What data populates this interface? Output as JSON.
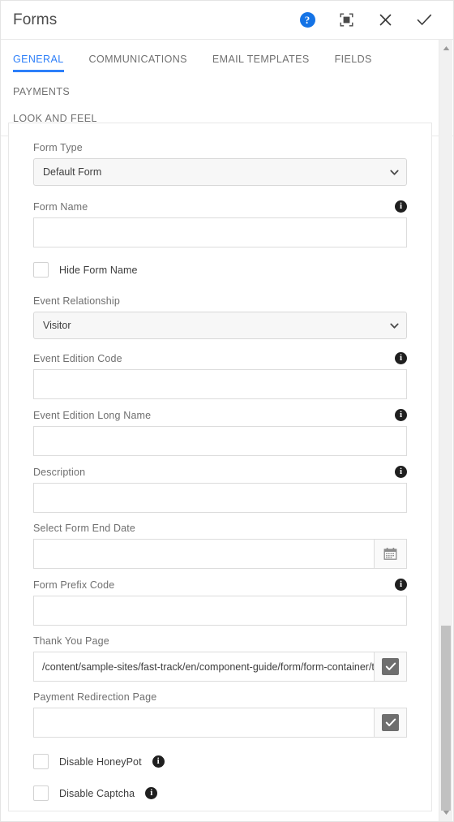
{
  "header": {
    "title": "Forms",
    "actions": [
      {
        "name": "help-icon",
        "label": "?"
      },
      {
        "name": "fullscreen-icon",
        "label": ""
      },
      {
        "name": "close-icon",
        "label": ""
      },
      {
        "name": "done-icon",
        "label": ""
      }
    ]
  },
  "tabs": {
    "row1": [
      {
        "label": "GENERAL",
        "active": true
      },
      {
        "label": "COMMUNICATIONS",
        "active": false
      },
      {
        "label": "EMAIL TEMPLATES",
        "active": false
      },
      {
        "label": "FIELDS",
        "active": false
      },
      {
        "label": "PAYMENTS",
        "active": false
      }
    ],
    "row2": [
      {
        "label": "LOOK AND FEEL",
        "active": false
      }
    ]
  },
  "form": {
    "form_type": {
      "label": "Form Type",
      "value": "Default Form"
    },
    "form_name": {
      "label": "Form Name",
      "value": "",
      "info": "i"
    },
    "hide_form_name": {
      "label": "Hide Form Name",
      "checked": false
    },
    "event_relationship": {
      "label": "Event Relationship",
      "value": "Visitor"
    },
    "event_edition_code": {
      "label": "Event Edition Code",
      "value": "",
      "info": "i"
    },
    "event_edition_long_name": {
      "label": "Event Edition Long Name",
      "value": "",
      "info": "i"
    },
    "description": {
      "label": "Description",
      "value": "",
      "info": "i"
    },
    "form_end_date": {
      "label": "Select Form End Date",
      "value": "",
      "button_icon": "calendar-icon"
    },
    "form_prefix_code": {
      "label": "Form Prefix Code",
      "value": "",
      "info": "i"
    },
    "thank_you_page": {
      "label": "Thank You Page",
      "value": "/content/sample-sites/fast-track/en/component-guide/form/form-container/t",
      "button_icon": "check-icon"
    },
    "payment_redirection_page": {
      "label": "Payment Redirection Page",
      "value": "",
      "button_icon": "check-icon"
    },
    "disable_honeypot": {
      "label": "Disable HoneyPot",
      "checked": false,
      "info": "i"
    },
    "disable_captcha": {
      "label": "Disable Captcha",
      "checked": false,
      "info": "i"
    }
  },
  "colors": {
    "accent": "#2d7ff9",
    "help_blue": "#1473e6",
    "info_dot": "#1f1f1f",
    "button_grey": "#6e6e6e",
    "scroll_thumb": "#c1c1c1"
  }
}
